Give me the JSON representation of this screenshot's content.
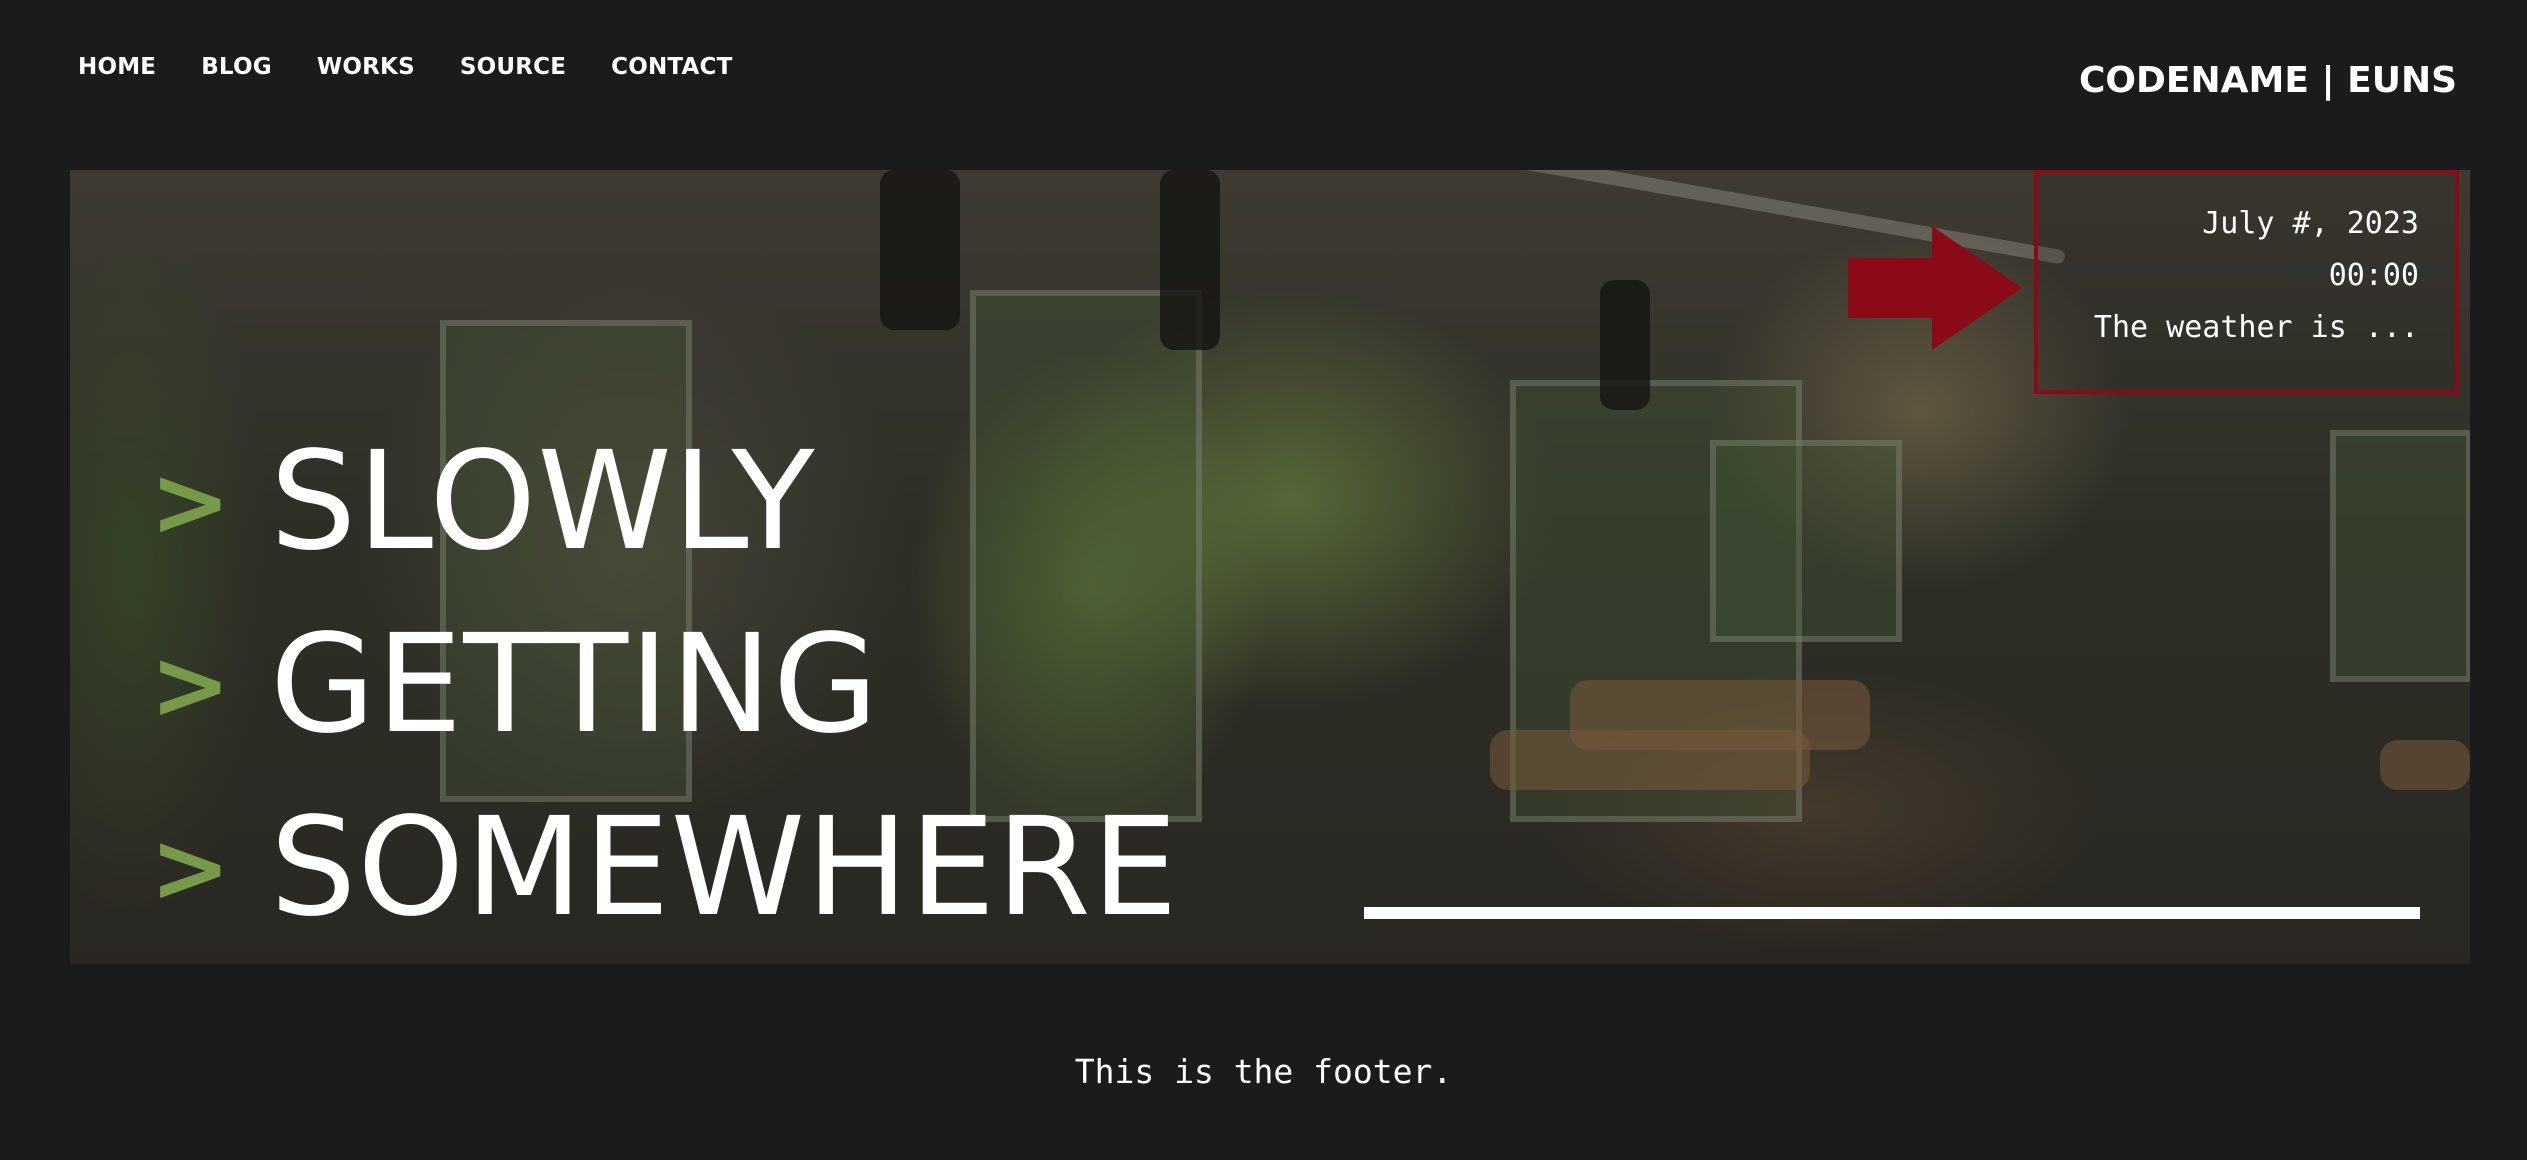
{
  "nav": {
    "items": [
      {
        "label": "HOME"
      },
      {
        "label": "BLOG"
      },
      {
        "label": "WORKS"
      },
      {
        "label": "SOURCE"
      },
      {
        "label": "CONTACT"
      }
    ]
  },
  "brand": {
    "title": "CODENAME | EUNS"
  },
  "hero": {
    "prompt_symbol": ">",
    "lines": [
      "SLOWLY",
      "GETTING",
      "SOMEWHERE"
    ]
  },
  "info_box": {
    "date": "July #, 2023",
    "time": "00:00",
    "weather": "The weather is ..."
  },
  "footer": {
    "text": "This is the footer."
  },
  "colors": {
    "background": "#1b1b1b",
    "prompt_green": "#779a48",
    "highlight_red": "#8b0a18",
    "text": "#ffffff"
  },
  "icons": {
    "arrow": "arrow-right-icon"
  }
}
